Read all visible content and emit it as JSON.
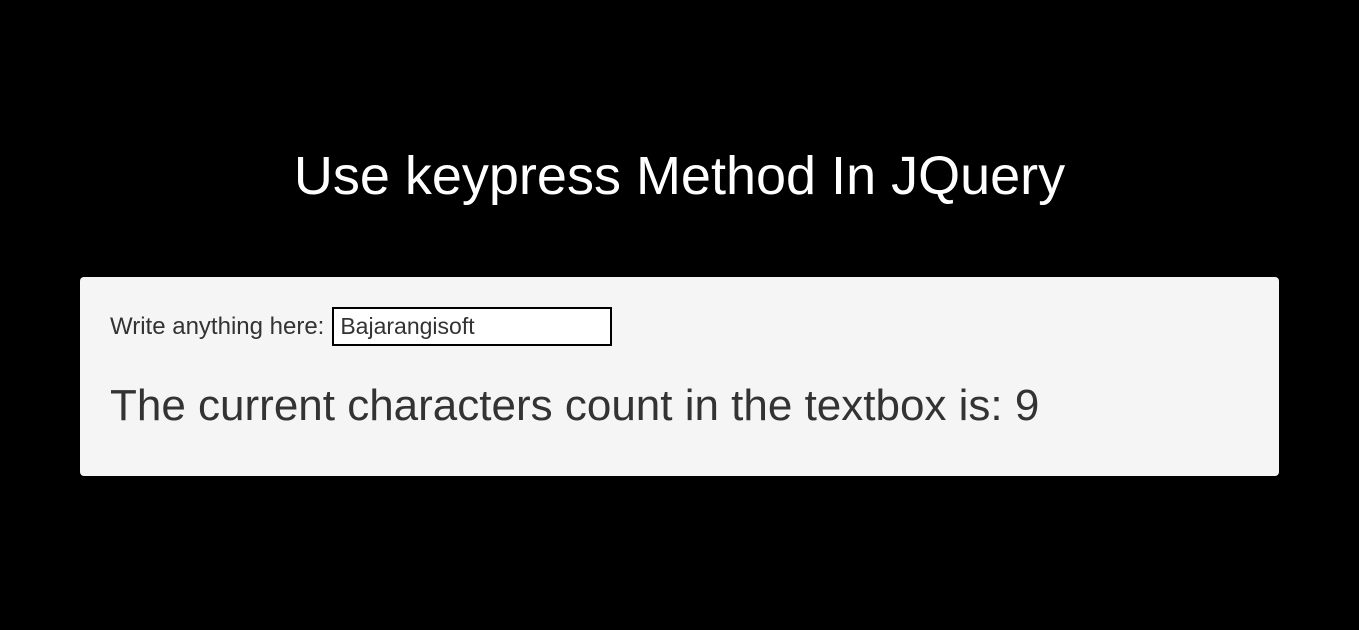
{
  "title": "Use keypress Method In JQuery",
  "input": {
    "label": "Write anything here: ",
    "value": "Bajarangisoft"
  },
  "count": {
    "prefix": "The current characters count in the textbox is: ",
    "value": "9"
  }
}
